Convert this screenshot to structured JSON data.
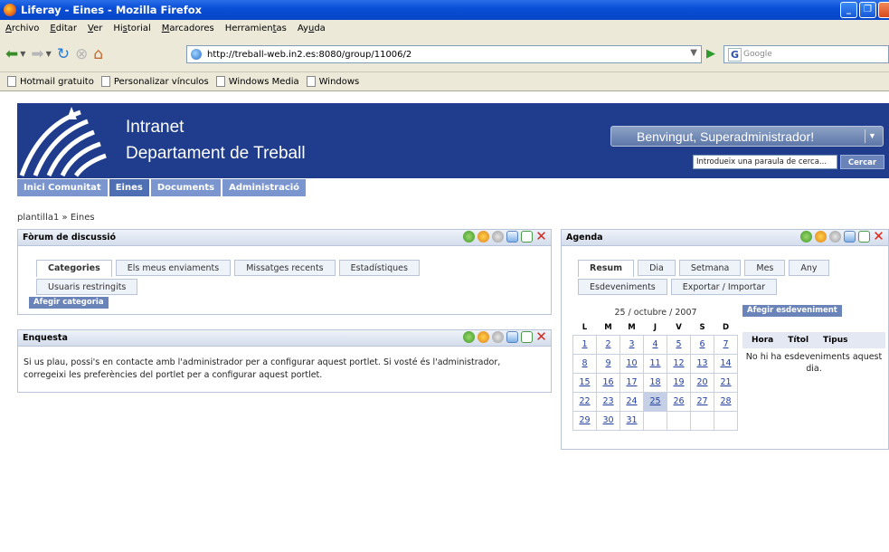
{
  "window": {
    "title": "Liferay - Eines - Mozilla Firefox"
  },
  "menu": [
    {
      "prefix": "",
      "u": "A",
      "rest": "rchivo"
    },
    {
      "prefix": "",
      "u": "E",
      "rest": "ditar"
    },
    {
      "prefix": "",
      "u": "V",
      "rest": "er"
    },
    {
      "prefix": "Hi",
      "u": "s",
      "rest": "torial"
    },
    {
      "prefix": "",
      "u": "M",
      "rest": "arcadores"
    },
    {
      "prefix": "Herramien",
      "u": "t",
      "rest": "as"
    },
    {
      "prefix": "Ay",
      "u": "u",
      "rest": "da"
    }
  ],
  "browser": {
    "url": "http://treball-web.in2.es:8080/group/11006/2",
    "search_engine_letter": "G",
    "search_placeholder": "Google"
  },
  "bookmarks": [
    "Hotmail gratuito",
    "Personalizar vínculos",
    "Windows Media",
    "Windows"
  ],
  "site": {
    "brand_line1": "Intranet",
    "brand_line2": "Departament de Treball",
    "welcome": "Benvingut, Superadministrador!",
    "search_value": "Introdueix una paraula de cerca...",
    "search_button": "Cercar",
    "tabs": [
      "Inici Comunitat",
      "Eines",
      "Documents",
      "Administració"
    ],
    "active_tab": "Eines",
    "breadcrumb": "plantilla1 » Eines"
  },
  "forum": {
    "title": "Fòrum de discussió",
    "tabs": [
      "Categories",
      "Els meus enviaments",
      "Missatges recents",
      "Estadístiques"
    ],
    "tab2": "Usuaris restringits",
    "add_button": "Afegir categoria"
  },
  "poll": {
    "title": "Enquesta",
    "message": "Si us plau, possi's en contacte amb l'administrador per a configurar aquest portlet. Si vosté és l'administrador, corregeixi les preferències del portlet per a configurar aquest portlet."
  },
  "agenda": {
    "title": "Agenda",
    "tabs": [
      "Resum",
      "Dia",
      "Setmana",
      "Mes",
      "Any"
    ],
    "tabs2": [
      "Esdeveniments",
      "Exportar / Importar"
    ],
    "date": "25 / octubre / 2007",
    "days": [
      "L",
      "M",
      "M",
      "J",
      "V",
      "S",
      "D"
    ],
    "weeks": [
      [
        "1",
        "2",
        "3",
        "4",
        "5",
        "6",
        "7"
      ],
      [
        "8",
        "9",
        "10",
        "11",
        "12",
        "13",
        "14"
      ],
      [
        "15",
        "16",
        "17",
        "18",
        "19",
        "20",
        "21"
      ],
      [
        "22",
        "23",
        "24",
        "25",
        "26",
        "27",
        "28"
      ],
      [
        "29",
        "30",
        "31",
        "",
        "",
        "",
        ""
      ]
    ],
    "today": "25",
    "add_event": "Afegir esdeveniment",
    "cols": [
      "Hora",
      "Títol",
      "Tipus"
    ],
    "empty": "No hi ha esdeveniments aquest dia."
  }
}
